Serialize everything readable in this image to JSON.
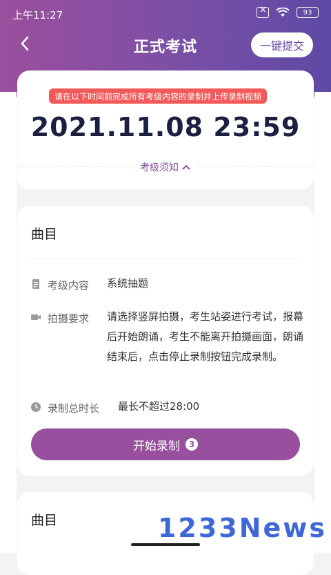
{
  "status": {
    "time": "上午11:27",
    "battery": "93"
  },
  "header": {
    "title": "正式考试",
    "submit_label": "一键提交"
  },
  "time_card": {
    "notice": "请在以下时间前完成所有考级内容的录制并上传录制视频",
    "deadline": "2021.11.08 23:59",
    "toggle_label": "考级须知"
  },
  "piece": {
    "title": "曲目",
    "content_label": "考级内容",
    "content_value": "系统抽题",
    "req_label": "拍摄要求",
    "req_value": "请选择竖屏拍摄，考生站姿进行考试，报幕后开始朗诵，考生不能离开拍摄画面，朗诵结束后，点击停止录制按钮完成录制。",
    "duration_label": "录制总时长",
    "duration_value": "最长不超过28:00",
    "start_label": "开始录制",
    "start_count": "3"
  },
  "piece2": {
    "title": "曲目"
  },
  "watermark": "1233News",
  "colors": {
    "accent": "#974f9e",
    "notice": "#f25a5a"
  }
}
